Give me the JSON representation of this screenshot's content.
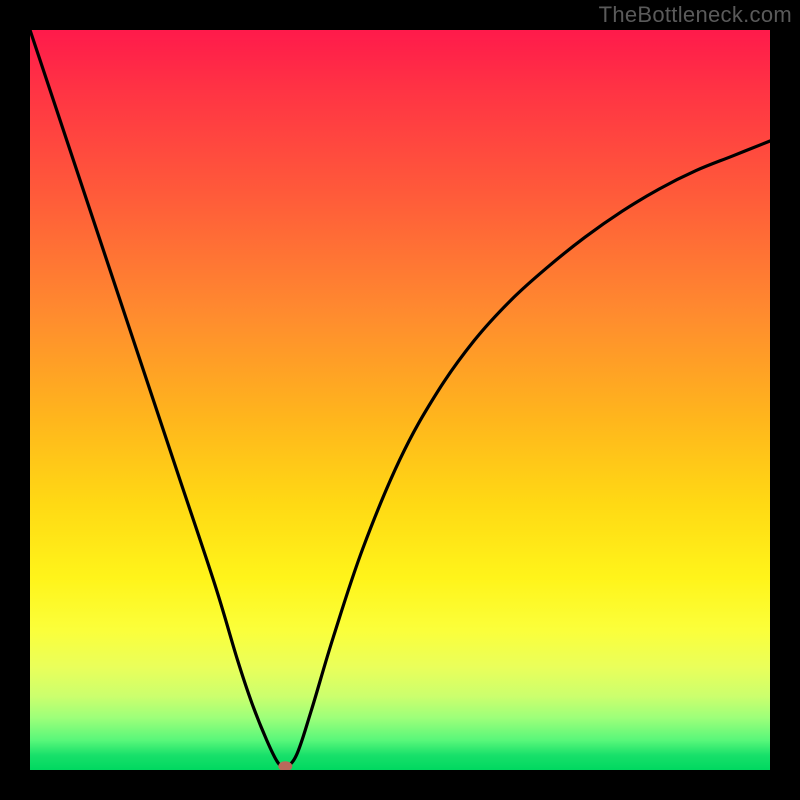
{
  "watermark": "TheBottleneck.com",
  "chart_data": {
    "type": "line",
    "title": "",
    "xlabel": "",
    "ylabel": "",
    "xlim": [
      0,
      100
    ],
    "ylim": [
      0,
      100
    ],
    "grid": false,
    "series": [
      {
        "name": "curve",
        "x": [
          0,
          5,
          10,
          15,
          20,
          25,
          28,
          30,
          32,
          33.5,
          34.5,
          36,
          38,
          41,
          45,
          50,
          55,
          60,
          65,
          70,
          75,
          80,
          85,
          90,
          95,
          100
        ],
        "y": [
          100,
          85,
          70,
          55,
          40,
          25,
          15,
          9,
          4,
          1,
          0.5,
          2,
          8,
          18,
          30,
          42,
          51,
          58,
          63.5,
          68,
          72,
          75.5,
          78.5,
          81,
          83,
          85
        ]
      }
    ],
    "minimum_marker": {
      "x": 34.5,
      "y": 0.5
    },
    "background_gradient": {
      "top": "#ff1a4b",
      "mid": "#ffd914",
      "bottom": "#00d860"
    }
  }
}
